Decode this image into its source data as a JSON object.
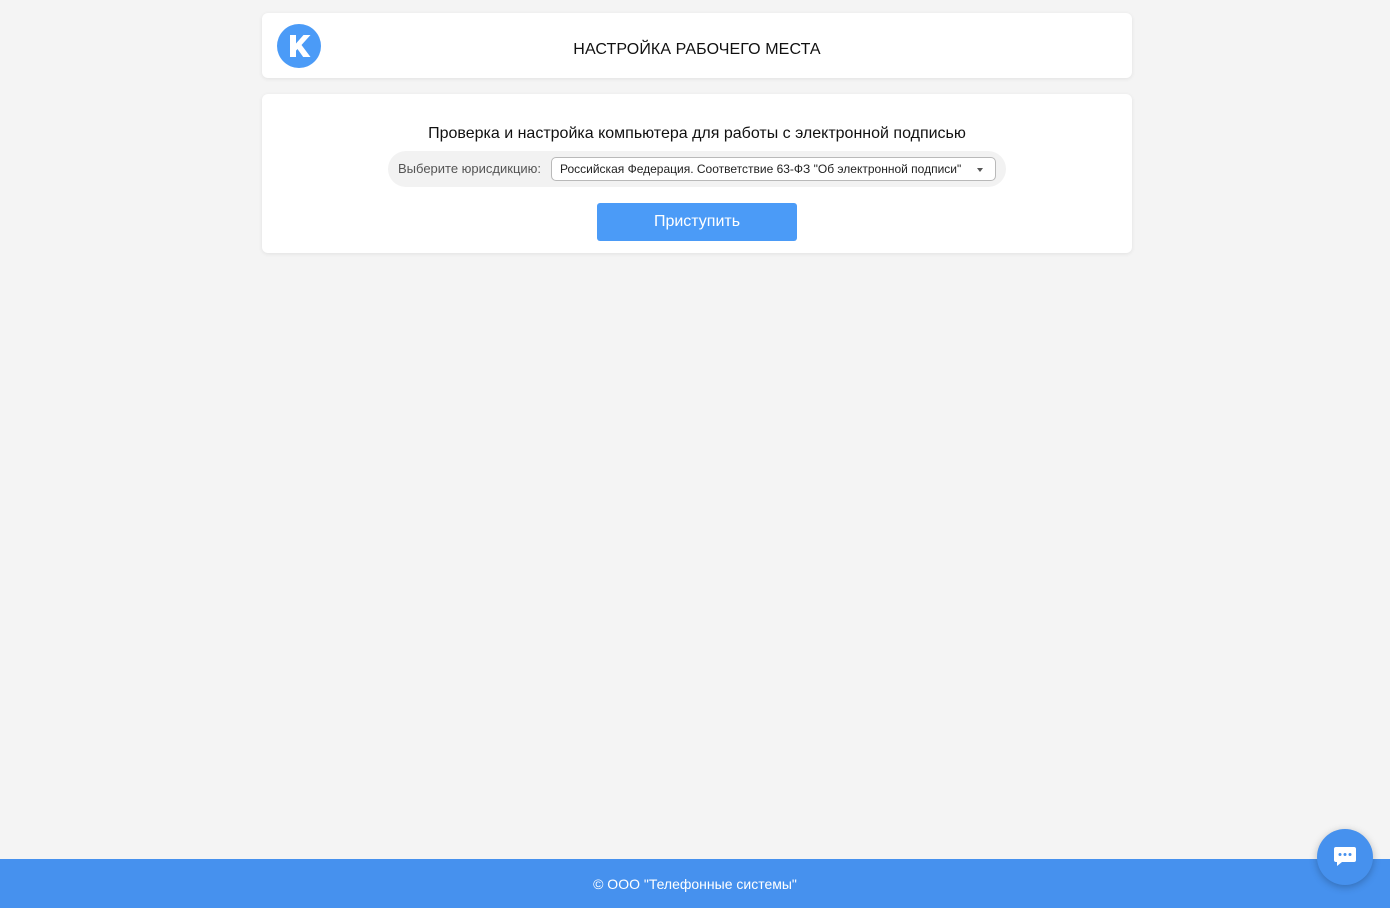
{
  "header": {
    "logo_icon": "k-logo-icon",
    "title": "НАСТРОЙКА РАБОЧЕГО МЕСТА"
  },
  "main": {
    "heading": "Проверка и настройка компьютера для работы с электронной подписью",
    "jurisdiction": {
      "label": "Выберите юрисдикцию:",
      "selected": "Российская Федерация. Соответствие 63-ФЗ \"Об электронной подписи\""
    },
    "start_button": "Приступить"
  },
  "footer": {
    "copyright": "© ООО \"Телефонные системы\""
  },
  "chat": {
    "icon": "chat-bubble-icon"
  },
  "colors": {
    "accent": "#4b9bf7",
    "footer": "#4691ee",
    "background": "#f4f4f4"
  }
}
